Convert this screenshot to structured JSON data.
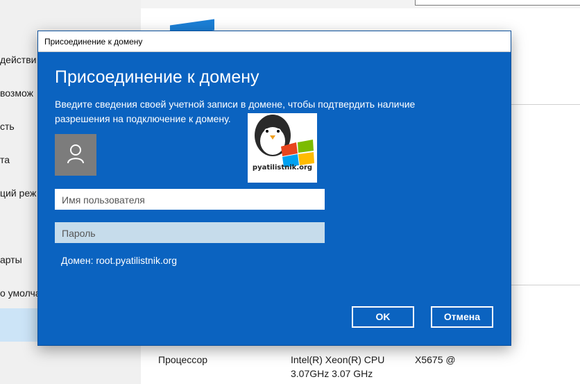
{
  "background": {
    "nav_items": [
      {
        "label": "действи"
      },
      {
        "label": "возмож"
      },
      {
        "label": "сть"
      },
      {
        "label": "та"
      },
      {
        "label": "ций реж"
      },
      {
        "label": "арты"
      },
      {
        "label": "о умолча"
      }
    ],
    "processor_label": "Процессор",
    "processor_value_line1": "Intel(R) Xeon(R) CPU",
    "processor_value_model": "X5675  @",
    "processor_value_line2": "3.07GHz   3.07 GHz"
  },
  "dialog": {
    "window_title": "Присоединение к домену",
    "heading": "Присоединение к домену",
    "description": "Введите сведения своей учетной записи в домене, чтобы подтвердить наличие разрешения на подключение к домену.",
    "username_placeholder": "Имя пользователя",
    "password_placeholder": "Пароль",
    "domain_text": "Домен: root.pyatilistnik.org",
    "ok_label": "OK",
    "cancel_label": "Отмена",
    "watermark_text": "pyatilistnik.org"
  },
  "colors": {
    "dialog_bg": "#0b63c0",
    "avatar_bg": "#7c7c7c",
    "password_bg": "#c6dceb"
  }
}
